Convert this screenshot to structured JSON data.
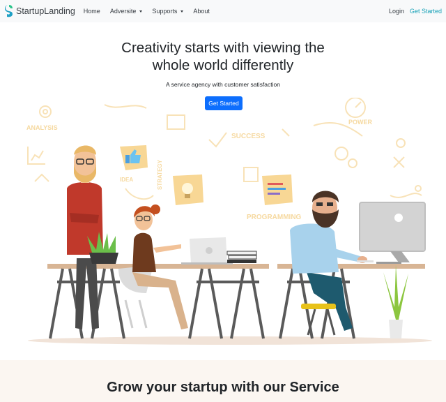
{
  "nav": {
    "brand": "StartupLanding",
    "links": [
      {
        "label": "Home"
      },
      {
        "label": "Adversite"
      },
      {
        "label": "Supports"
      },
      {
        "label": "About"
      }
    ],
    "login": "Login",
    "get_started": "Get Started"
  },
  "hero": {
    "title_line1": "Creativity starts with viewing the",
    "title_line2": "whole world differently",
    "subtitle": "A service agency with customer satisfaction",
    "cta": "Get Started"
  },
  "illustration": {
    "labels": [
      "ANALYSIS",
      "SUCCESS",
      "POWER",
      "STRATEGY",
      "IDEA",
      "PROGRAMMING"
    ]
  },
  "section": {
    "title": "Grow your startup with our Service"
  },
  "colors": {
    "accent": "#0d6efd",
    "nav_link_accent": "#17a2b8",
    "doodle": "#f6d9a0",
    "section_bg": "#fbf6f1"
  }
}
